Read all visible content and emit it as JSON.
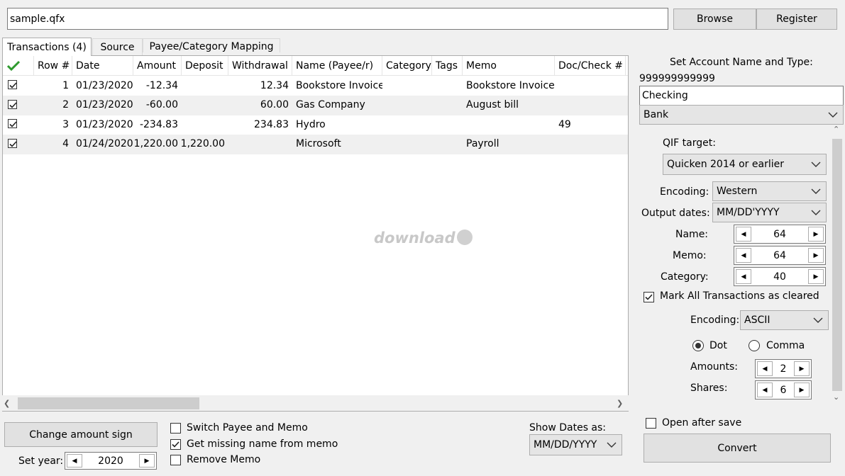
{
  "file": {
    "path": "sample.qfx",
    "browse_label": "Browse",
    "register_label": "Register"
  },
  "tabs": [
    {
      "label": "Transactions (4)"
    },
    {
      "label": "Source"
    },
    {
      "label": "Payee/Category Mapping"
    }
  ],
  "table": {
    "headers": [
      "Row #",
      "Date",
      "Amount",
      "Deposit",
      "Withdrawal",
      "Name (Payee/r)",
      "Category",
      "Tags",
      "Memo",
      "Doc/Check #"
    ],
    "rows": [
      {
        "checked": true,
        "row": "1",
        "date": "01/23/2020",
        "amount": "-12.34",
        "deposit": "",
        "withdrawal": "12.34",
        "name": "Bookstore Invoice",
        "category": "",
        "tags": "",
        "memo": "Bookstore Invoice",
        "doc": ""
      },
      {
        "checked": true,
        "row": "2",
        "date": "01/23/2020",
        "amount": "-60.00",
        "deposit": "",
        "withdrawal": "60.00",
        "name": "Gas Company",
        "category": "",
        "tags": "",
        "memo": "August bill",
        "doc": ""
      },
      {
        "checked": true,
        "row": "3",
        "date": "01/23/2020",
        "amount": "-234.83",
        "deposit": "",
        "withdrawal": "234.83",
        "name": "Hydro",
        "category": "",
        "tags": "",
        "memo": "",
        "doc": "49"
      },
      {
        "checked": true,
        "row": "4",
        "date": "01/24/2020",
        "amount": "1,220.00",
        "deposit": "1,220.00",
        "withdrawal": "",
        "name": "Microsoft",
        "category": "",
        "tags": "",
        "memo": "Payroll",
        "doc": ""
      }
    ]
  },
  "watermark": "download",
  "account": {
    "title": "Set Account Name and Type:",
    "number": "999999999999",
    "name": "Checking",
    "type": "Bank"
  },
  "settings": {
    "qif_target_label": "QIF target:",
    "qif_target": "Quicken 2014 or earlier",
    "encoding_label": "Encoding:",
    "encoding": "Western",
    "output_dates_label": "Output dates:",
    "output_dates": "MM/DD'YYYY",
    "name_label": "Name:",
    "name_len": "64",
    "memo_label": "Memo:",
    "memo_len": "64",
    "category_label": "Category:",
    "category_len": "40",
    "mark_cleared_label": "Mark All Transactions as cleared",
    "mark_cleared": true,
    "encoding2_label": "Encoding:",
    "encoding2": "ASCII",
    "dot_label": "Dot",
    "comma_label": "Comma",
    "decimal_sep": "dot",
    "amounts_label": "Amounts:",
    "amounts": "2",
    "shares_label": "Shares:",
    "shares": "6"
  },
  "bottom": {
    "change_sign_label": "Change amount sign",
    "set_year_label": "Set year:",
    "year": "2020",
    "switch_payee_label": "Switch Payee and Memo",
    "switch_payee": false,
    "get_missing_label": "Get missing name from memo",
    "get_missing": true,
    "remove_memo_label": "Remove Memo",
    "remove_memo": false,
    "show_dates_label": "Show Dates as:",
    "show_dates": "MM/DD/YYYY",
    "open_after_label": "Open after save",
    "open_after": false,
    "convert_label": "Convert"
  }
}
